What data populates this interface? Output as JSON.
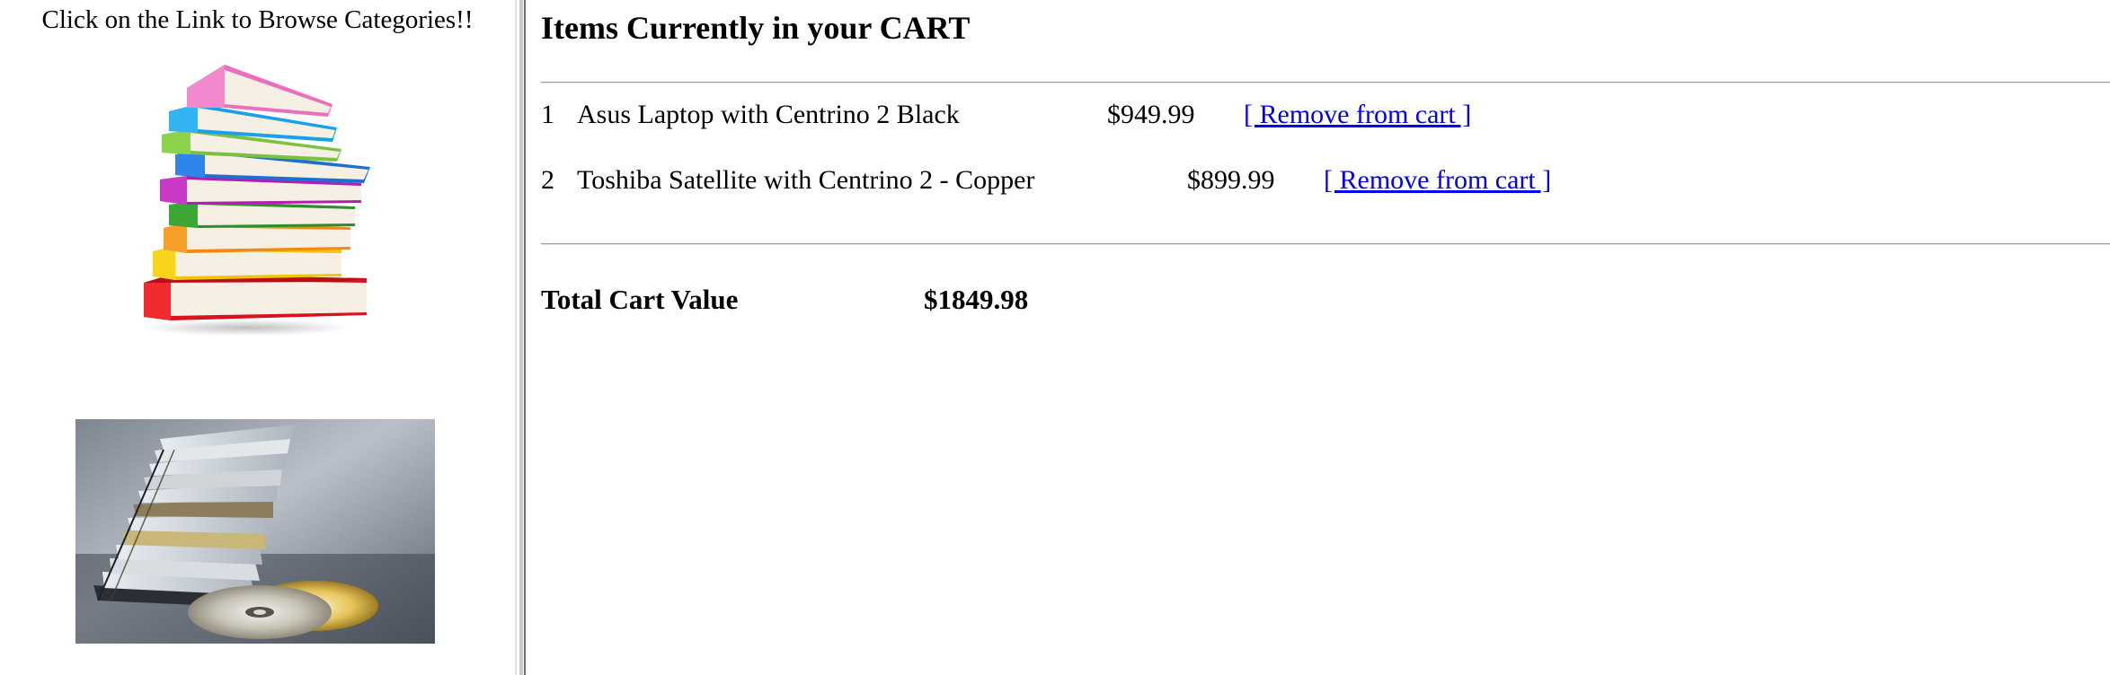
{
  "sidebar": {
    "heading": "Click on the Link to Browse Categories!!",
    "categories": [
      {
        "name": "books-category-image",
        "icon": "stack-of-books-image"
      },
      {
        "name": "cds-category-image",
        "icon": "stack-of-cds-image"
      }
    ]
  },
  "cart": {
    "title": "Items Currently in your CART",
    "items": [
      {
        "number": "1",
        "name": "Asus Laptop with Centrino 2 Black",
        "price": "$949.99",
        "action": "[ Remove from cart ]"
      },
      {
        "number": "2",
        "name": "Toshiba Satellite with Centrino 2 - Copper",
        "price": "$899.99",
        "action": "[ Remove from cart ]"
      }
    ],
    "total_label": "Total Cart Value",
    "total_value": "$1849.98"
  },
  "colors": {
    "link": "#0000ee",
    "text": "#000000",
    "background": "#ffffff"
  }
}
